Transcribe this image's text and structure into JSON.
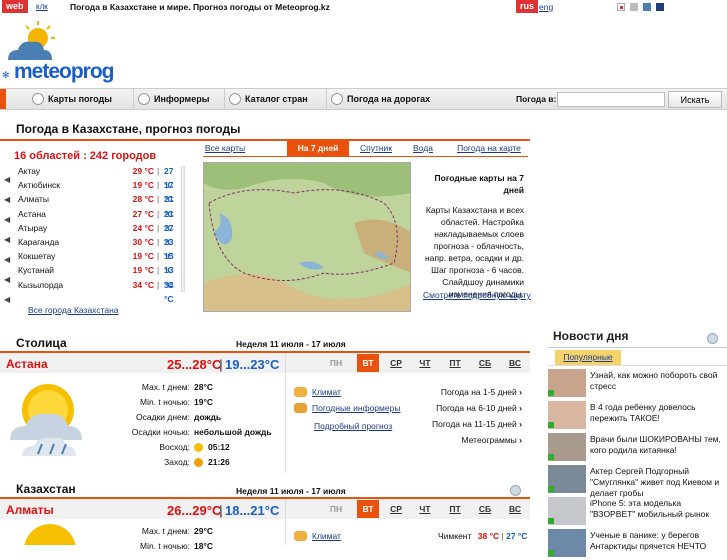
{
  "top": {
    "web_tag": "web",
    "klk": "клк",
    "headline": "Погода в Казахстане и мире. Прогноз погоды от Meteoprog.kz",
    "lang_active": "rus",
    "lang_other": "eng"
  },
  "logo": {
    "text": "meteoprog"
  },
  "nav": {
    "items": [
      "Карты погоды",
      "Информеры",
      "Каталог стран",
      "Погода на дорогах"
    ],
    "search_label": "Погода в:",
    "search_value": "",
    "search_button": "Искать"
  },
  "main": {
    "title": "Погода в Казахстане, прогноз погоды",
    "regions": "16 областей : 242 городов",
    "cities": [
      {
        "name": "Актау",
        "day": "29 °C",
        "night": "27 °C"
      },
      {
        "name": "Актюбинск",
        "day": "19 °C",
        "night": "17 °C"
      },
      {
        "name": "Алматы",
        "day": "28 °C",
        "night": "21 °C"
      },
      {
        "name": "Астана",
        "day": "27 °C",
        "night": "21 °C"
      },
      {
        "name": "Атырау",
        "day": "24 °C",
        "night": "27 °C"
      },
      {
        "name": "Караганда",
        "day": "30 °C",
        "night": "23 °C"
      },
      {
        "name": "Кокшетау",
        "day": "19 °C",
        "night": "15 °C"
      },
      {
        "name": "Кустанай",
        "day": "19 °C",
        "night": "13 °C"
      },
      {
        "name": "Кызылорда",
        "day": "34 °C",
        "night": "34 °C"
      }
    ],
    "all_cities": "Все города Казахстана",
    "tabs": [
      "Все карты",
      "На 7 дней",
      "Спутник",
      "Вода",
      "Погода на карте"
    ],
    "map_desc_title": "Погодные карты на 7 дней",
    "map_desc": "Карты Казахстана и всех областей. Настройка накладываемых слоев прогноза - облачность, напр. ветра, осадки и др. Шаг прогноза - 6 часов. Слайдшоу динамики изменения погоды.",
    "map_link": "Смотреть подробную карту"
  },
  "capital": {
    "section": "Столица",
    "week": "Неделя 11 июля - 17 июля",
    "city": "Астана",
    "day_temp": "25...28°C",
    "night_temp": "19...23°C",
    "labels": [
      "Max. t днем:",
      "Min. t ночью:",
      "Осадки днем:",
      "Осадки ночью:",
      "Восход:",
      "Заход:"
    ],
    "values": [
      "28°C",
      "19°C",
      "дождь",
      "небольшой дождь",
      "05:12",
      "21:26"
    ],
    "days": [
      "ПН",
      "ВТ",
      "СР",
      "ЧТ",
      "ПТ",
      "СБ",
      "ВС"
    ],
    "links": [
      "Климат",
      "Погодные информеры",
      "Подробный прогноз"
    ],
    "right_links": [
      "Погода на 1-5 дней",
      "Погода на 6-10 дней",
      "Погода на 11-15 дней",
      "Метеограммы"
    ]
  },
  "kz": {
    "section": "Казахстан",
    "week": "Неделя 11 июля - 17 июля",
    "city": "Алматы",
    "day_temp": "26...29°C",
    "night_temp": "18...21°C",
    "labels": [
      "Max. t днем:",
      "Min. t ночью:"
    ],
    "values": [
      "29°C",
      "18°C"
    ],
    "days": [
      "ПН",
      "ВТ",
      "СР",
      "ЧТ",
      "ПТ",
      "СБ",
      "ВС"
    ],
    "link": "Климат",
    "city2": "Чимкент",
    "city2_day": "38 °C",
    "city2_night": "27 °C"
  },
  "news": {
    "title": "Новости дня",
    "tab": "Популярные",
    "items": [
      "Узнай, как можно побороть свой стресс",
      "В 4 года ребенку довелось пережить ТАКОЕ!",
      "Врачи были ШОКИРОВАНЫ тем, кого родила китаянка!",
      "Актер Сергей Подгорный \"Смуглянка\" живет под Киевом и делает гробы",
      "iPhone 5: эта моделька \"ВЗОРВЕТ\" мобильный рынок",
      "Ученые в панике: у берегов Антарктиды прячется НЕЧТО"
    ]
  },
  "colors": {
    "accent": "#e8520c",
    "day": "#dd1111",
    "night": "#1a5fc8",
    "link": "#1a3c8f"
  }
}
